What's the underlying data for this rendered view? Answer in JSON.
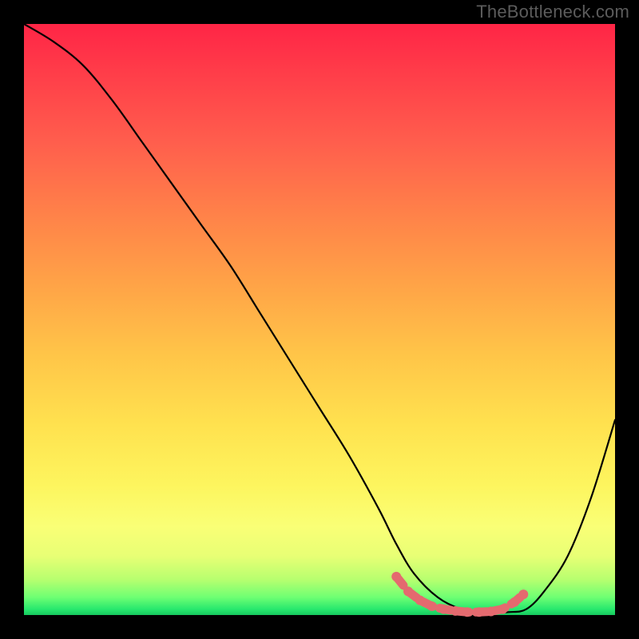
{
  "watermark": "TheBottleneck.com",
  "chart_data": {
    "type": "line",
    "title": "",
    "xlabel": "",
    "ylabel": "",
    "xlim": [
      0,
      100
    ],
    "ylim": [
      0,
      100
    ],
    "series": [
      {
        "name": "bottleneck-curve",
        "x": [
          0,
          5,
          10,
          15,
          20,
          25,
          30,
          35,
          40,
          45,
          50,
          55,
          60,
          63,
          66,
          70,
          74,
          78,
          82,
          85,
          88,
          92,
          96,
          100
        ],
        "y": [
          100,
          97,
          93,
          87,
          80,
          73,
          66,
          59,
          51,
          43,
          35,
          27,
          18,
          12,
          7,
          3,
          1,
          0.5,
          0.5,
          1,
          4,
          10,
          20,
          33
        ]
      }
    ],
    "markers": {
      "name": "optimal-zone",
      "color": "#e46a6f",
      "points_x": [
        63,
        65,
        67,
        69,
        71,
        73,
        75,
        77,
        79,
        81,
        83,
        84.5
      ],
      "points_y": [
        6.5,
        4.0,
        2.5,
        1.5,
        1.0,
        0.7,
        0.5,
        0.5,
        0.6,
        1.0,
        2.2,
        3.5
      ]
    },
    "gradient_stops": [
      {
        "pos": 0,
        "color": "#ff2546"
      },
      {
        "pos": 50,
        "color": "#ffb747"
      },
      {
        "pos": 82,
        "color": "#fcff70"
      },
      {
        "pos": 100,
        "color": "#17c95f"
      }
    ]
  }
}
